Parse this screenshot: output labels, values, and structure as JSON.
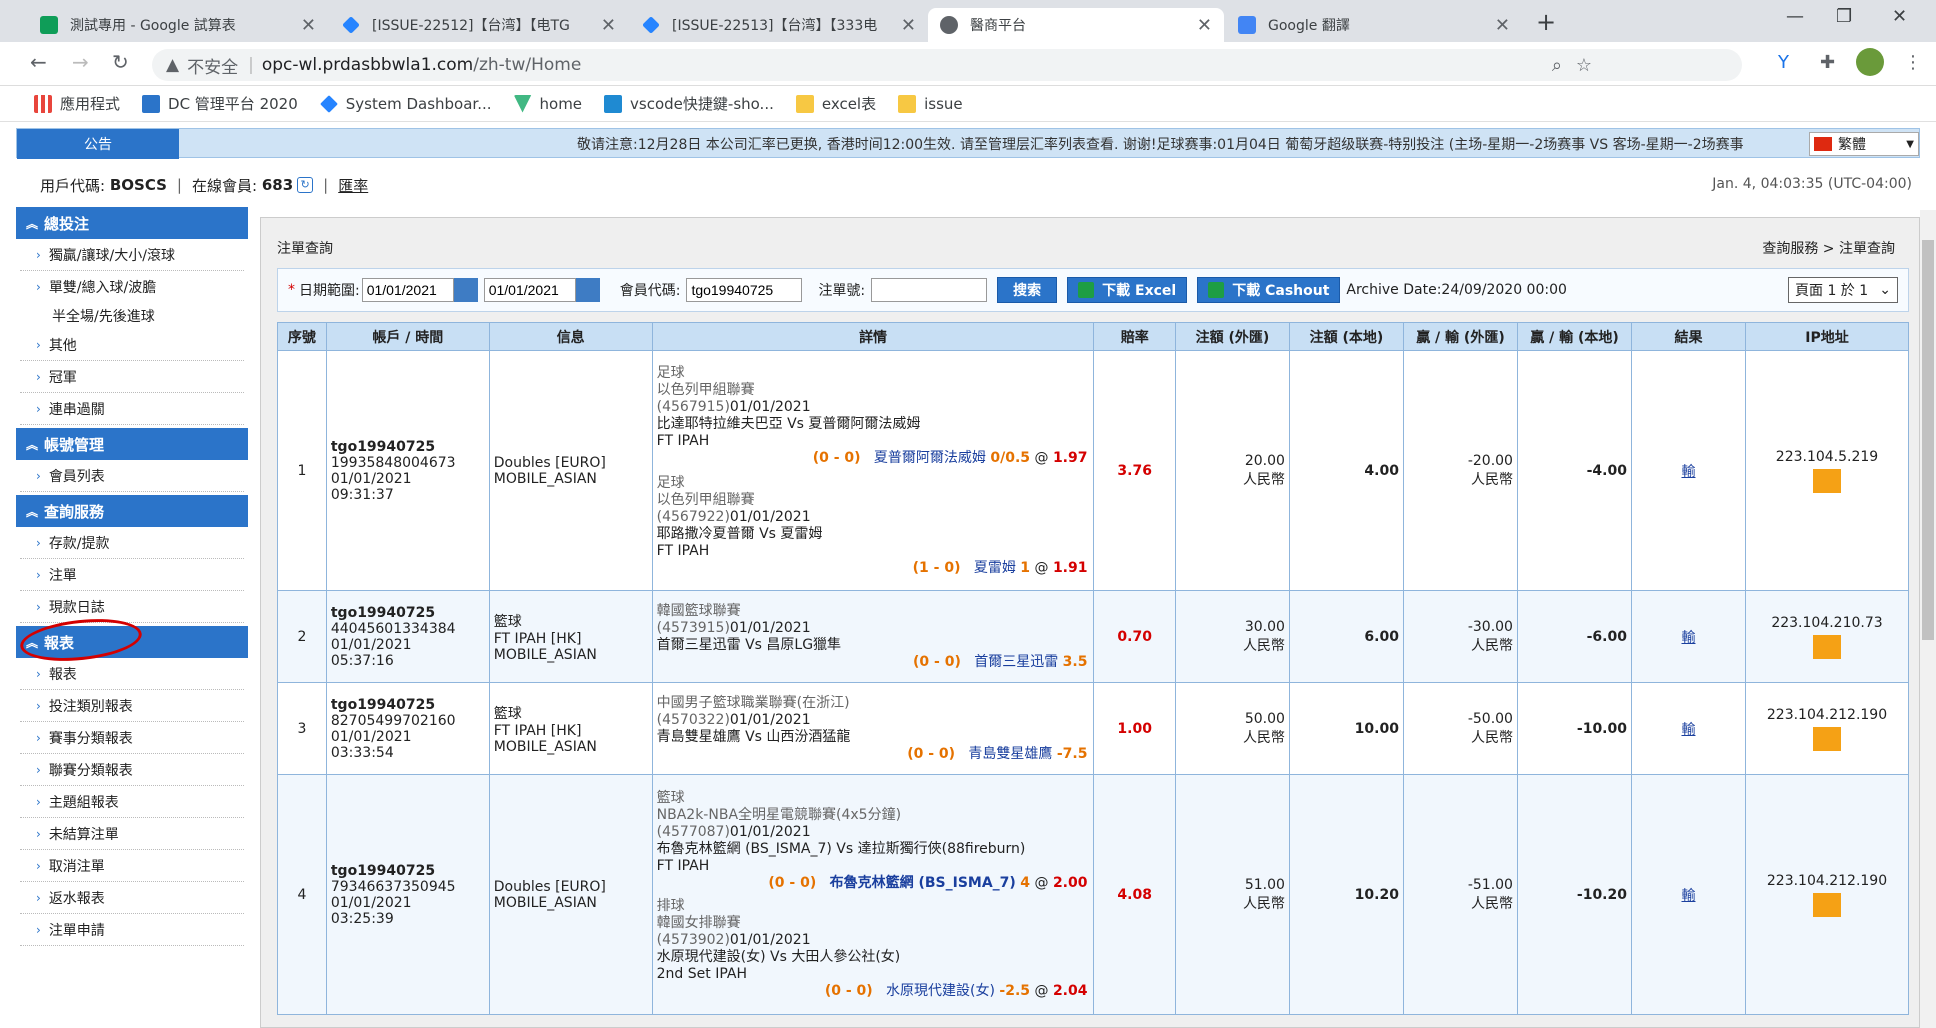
{
  "browser": {
    "tabs": [
      {
        "label": "測試專用 - Google 試算表",
        "icon_color": "#0f9d58"
      },
      {
        "label": "[ISSUE-22512]【台湾】【电TG",
        "icon_color": "#2684ff"
      },
      {
        "label": "[ISSUE-22513]【台湾】【333电",
        "icon_color": "#2684ff"
      },
      {
        "label": "醫商平台",
        "icon_color": "#5f6368"
      },
      {
        "label": "Google 翻譯",
        "icon_color": "#4285f4"
      }
    ],
    "insecure_label": "不安全",
    "url_host": "opc-wl.prdasbbwla1.com",
    "url_path": "/zh-tw/Home",
    "bookmarks": [
      "應用程式",
      "DC 管理平台 2020",
      "System Dashboar...",
      "home",
      "vscode快捷鍵-sho...",
      "excel表",
      "issue"
    ]
  },
  "notice": {
    "label": "公告",
    "text": "敬请注意:12月28日 本公司汇率已更换, 香港时间12:00生效. 请至管理层汇率列表查看. 谢谢!足球赛事:01月04日 葡萄牙超级联赛-特别投注 (主场-星期一-2场赛事 VS 客场-星期一-2场赛事",
    "lang": "繁體"
  },
  "user": {
    "code_label": "用戶代碼:",
    "code": "BOSCS",
    "online_label": "在線會員:",
    "online": "683",
    "rate_link": "匯率"
  },
  "clock": "Jan. 4, 04:03:35 (UTC-04:00)",
  "sidebar": {
    "sections": [
      {
        "title": "總投注",
        "items": [
          "獨贏/讓球/大小/滾球",
          "單雙/總入球/波膽",
          "半全場/先後進球",
          "其他",
          "冠軍",
          "連串過關"
        ]
      },
      {
        "title": "帳號管理",
        "items": [
          "會員列表"
        ]
      },
      {
        "title": "查詢服務",
        "items": [
          "存款/提款",
          "注單",
          "現款日誌"
        ]
      },
      {
        "title": "報表",
        "items": [
          "報表",
          "投注類別報表",
          "賽事分類報表",
          "聯賽分類報表",
          "主題組報表",
          "未結算注單",
          "取消注單",
          "返水報表",
          "注單申請"
        ]
      }
    ]
  },
  "main": {
    "title": "注單查詢",
    "breadcrumb": "查詢服務 > 注單查詢",
    "filter": {
      "date_range_label": "日期範圍:",
      "date_from": "01/01/2021",
      "date_to": "01/01/2021",
      "member_label": "會員代碼:",
      "member_value": "tgo19940725",
      "ticket_label": "注單號:",
      "ticket_value": "",
      "search_btn": "搜索",
      "excel_btn": "下載 Excel",
      "cashout_btn": "下載 Cashout",
      "archive": "Archive Date:24/09/2020 00:00",
      "pager": "頁面 1 於 1"
    },
    "columns": [
      "序號",
      "帳戶 / 時間",
      "信息",
      "詳情",
      "賠率",
      "注額 (外匯)",
      "注額 (本地)",
      "贏 / 輸 (外匯)",
      "贏 / 輸 (本地)",
      "結果",
      "IP地址"
    ],
    "rows": [
      {
        "no": "1",
        "account": "tgo19940725",
        "ticket": "19935848004673",
        "date": "01/01/2021",
        "time": "09:31:37",
        "info1": "Doubles [EURO]",
        "info2": "MOBILE_ASIAN",
        "legs": [
          {
            "sport": "足球",
            "league": "以色列甲組聯賽",
            "event_id": "(4567915)",
            "event_date": "01/01/2021",
            "match": "比達耶特拉維夫巴亞 Vs 夏普爾阿爾法威姆",
            "market": "FT IPAH",
            "score": "(0 - 0)",
            "pick": "夏普爾阿爾法威姆",
            "handicap": "0/0.5",
            "odds": "1.97"
          },
          {
            "sport": "足球",
            "league": "以色列甲組聯賽",
            "event_id": "(4567922)",
            "event_date": "01/01/2021",
            "match": "耶路撒冷夏普爾 Vs 夏雷姆",
            "market": "FT IPAH",
            "score": "(1 - 0)",
            "pick": "夏雷姆",
            "handicap": "1",
            "odds": "1.91"
          }
        ],
        "odds": "3.76",
        "stake_fx": "20.00",
        "currency": "人民幣",
        "stake_local": "4.00",
        "wl_fx": "-20.00",
        "wl_local": "-4.00",
        "result": "輸",
        "ip": "223.104.5.219"
      },
      {
        "no": "2",
        "account": "tgo19940725",
        "ticket": "44045601334384",
        "date": "01/01/2021",
        "time": "05:37:16",
        "info1": "籃球",
        "info2": "FT IPAH [HK]",
        "info3": "MOBILE_ASIAN",
        "legs": [
          {
            "sport": "",
            "league": "韓國籃球聯賽",
            "event_id": "(4573915)",
            "event_date": "01/01/2021",
            "match": "首爾三星迅雷 Vs 昌原LG獵隼",
            "market": "",
            "score": "(0 - 0)",
            "pick": "首爾三星迅雷",
            "handicap": "3.5",
            "odds": ""
          }
        ],
        "odds": "0.70",
        "stake_fx": "30.00",
        "currency": "人民幣",
        "stake_local": "6.00",
        "wl_fx": "-30.00",
        "wl_local": "-6.00",
        "result": "輸",
        "ip": "223.104.210.73"
      },
      {
        "no": "3",
        "account": "tgo19940725",
        "ticket": "82705499702160",
        "date": "01/01/2021",
        "time": "03:33:54",
        "info1": "籃球",
        "info2": "FT IPAH [HK]",
        "info3": "MOBILE_ASIAN",
        "legs": [
          {
            "sport": "",
            "league": "中國男子籃球職業聯賽(在浙江)",
            "event_id": "(4570322)",
            "event_date": "01/01/2021",
            "match": "青島雙星雄鷹 Vs 山西汾酒猛龍",
            "market": "",
            "score": "(0 - 0)",
            "pick": "青島雙星雄鷹",
            "handicap": "-7.5",
            "odds": ""
          }
        ],
        "odds": "1.00",
        "stake_fx": "50.00",
        "currency": "人民幣",
        "stake_local": "10.00",
        "wl_fx": "-50.00",
        "wl_local": "-10.00",
        "result": "輸",
        "ip": "223.104.212.190"
      },
      {
        "no": "4",
        "account": "tgo19940725",
        "ticket": "79346637350945",
        "date": "01/01/2021",
        "time": "03:25:39",
        "info1": "Doubles [EURO]",
        "info2": "MOBILE_ASIAN",
        "legs": [
          {
            "sport": "籃球",
            "league": "NBA2k-NBA全明星電競聯賽(4x5分鐘)",
            "event_id": "(4577087)",
            "event_date": "01/01/2021",
            "match": "布魯克林籃網 (BS_ISMA_7) Vs 達拉斯獨行俠(88fireburn)",
            "market": "FT IPAH",
            "score": "(0 - 0)",
            "pick": "布魯克林籃網 (BS_ISMA_7)",
            "handicap": "4",
            "odds": "2.00"
          },
          {
            "sport": "排球",
            "league": "韓國女排聯賽",
            "event_id": "(4573902)",
            "event_date": "01/01/2021",
            "match": "水原現代建設(女) Vs 大田人參公社(女)",
            "market": "2nd Set IPAH",
            "score": "(0 - 0)",
            "pick": "水原現代建設(女)",
            "handicap": "-2.5",
            "odds": "2.04"
          }
        ],
        "odds": "4.08",
        "stake_fx": "51.00",
        "currency": "人民幣",
        "stake_local": "10.20",
        "wl_fx": "-51.00",
        "wl_local": "-10.20",
        "result": "輸",
        "ip": "223.104.212.190"
      }
    ]
  }
}
